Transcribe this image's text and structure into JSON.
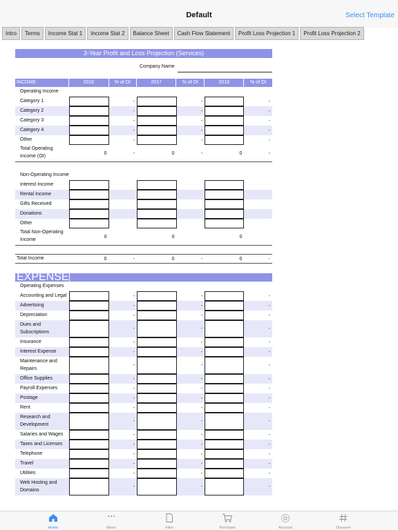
{
  "app": {
    "title": "Default",
    "select_template": "Select Template"
  },
  "tabs": [
    "Intro",
    "Terms",
    "Income Stat 1",
    "Income Stat 2",
    "Balance Sheet",
    "Cash Flow Statement",
    "Profit Loss Projection 1",
    "Profit Loss Projection 2"
  ],
  "sheet": {
    "title": "3-Year Profit and Loss Projection (Services)",
    "company_label": "Company Name",
    "income_header": {
      "label": "INCOME",
      "y1": "2016",
      "p1": "% of OI",
      "y2": "2017",
      "p2": "% of OI",
      "y3": "2018",
      "p3": "% of OI"
    },
    "operating_income_label": "Operating Income",
    "operating_rows": [
      "Category 1",
      "Category 2",
      "Category 3",
      "Category 4",
      "Other"
    ],
    "total_operating": {
      "label": "Total Operating Income (OI)",
      "v1": "0",
      "p1": "-",
      "v2": "0",
      "p2": "-",
      "v3": "0",
      "p3": "-"
    },
    "non_operating_label": "Non-Operating Income",
    "non_operating_rows": [
      "Interest Income",
      "Rental Income",
      "Gifts Received",
      "Donations",
      "Other"
    ],
    "total_non_operating": {
      "label": "Total Non-Operating Income",
      "v1": "0",
      "v2": "0",
      "v3": "0"
    },
    "total_income": {
      "label": "Total Income",
      "v1": "0",
      "p1": "-",
      "v2": "0",
      "p2": "-",
      "v3": "0",
      "p3": "-"
    },
    "expenses_header": "EXPENSES",
    "operating_expenses_label": "Operating Expenses",
    "expense_rows": [
      {
        "label": "Accounting and Legal",
        "tall": false
      },
      {
        "label": "Advertising",
        "tall": false
      },
      {
        "label": "Depreciation",
        "tall": false
      },
      {
        "label": "Dues and Subscriptions",
        "tall": true
      },
      {
        "label": "Insurance",
        "tall": false
      },
      {
        "label": "Interest Expense",
        "tall": false
      },
      {
        "label": "Maintenance and Repairs",
        "tall": true
      },
      {
        "label": "Office Supplies",
        "tall": false
      },
      {
        "label": "Payroll Expenses",
        "tall": false
      },
      {
        "label": "Postage",
        "tall": false
      },
      {
        "label": "Rent",
        "tall": false
      },
      {
        "label": "Research and Development",
        "tall": true
      },
      {
        "label": "Salaries and Wages",
        "tall": false
      },
      {
        "label": "Taxes and Licenses",
        "tall": false
      },
      {
        "label": "Telephone",
        "tall": false
      },
      {
        "label": "Travel",
        "tall": false
      },
      {
        "label": "Utilities",
        "tall": false
      },
      {
        "label": "Web Hosting and Domains",
        "tall": true
      }
    ],
    "dash": "-"
  },
  "tabbar": [
    {
      "label": "Home",
      "icon": "home-icon",
      "active": true
    },
    {
      "label": "Menu",
      "icon": "more-icon",
      "active": false
    },
    {
      "label": "Files",
      "icon": "file-icon",
      "active": false
    },
    {
      "label": "Purchase",
      "icon": "cart-icon",
      "active": false
    },
    {
      "label": "Account",
      "icon": "gear-icon",
      "active": false
    },
    {
      "label": "Discover",
      "icon": "hash-icon",
      "active": false
    }
  ],
  "colors": {
    "accent": "#3a8ef2",
    "header": "#8f93e6",
    "shade": "#e6e8f9"
  }
}
